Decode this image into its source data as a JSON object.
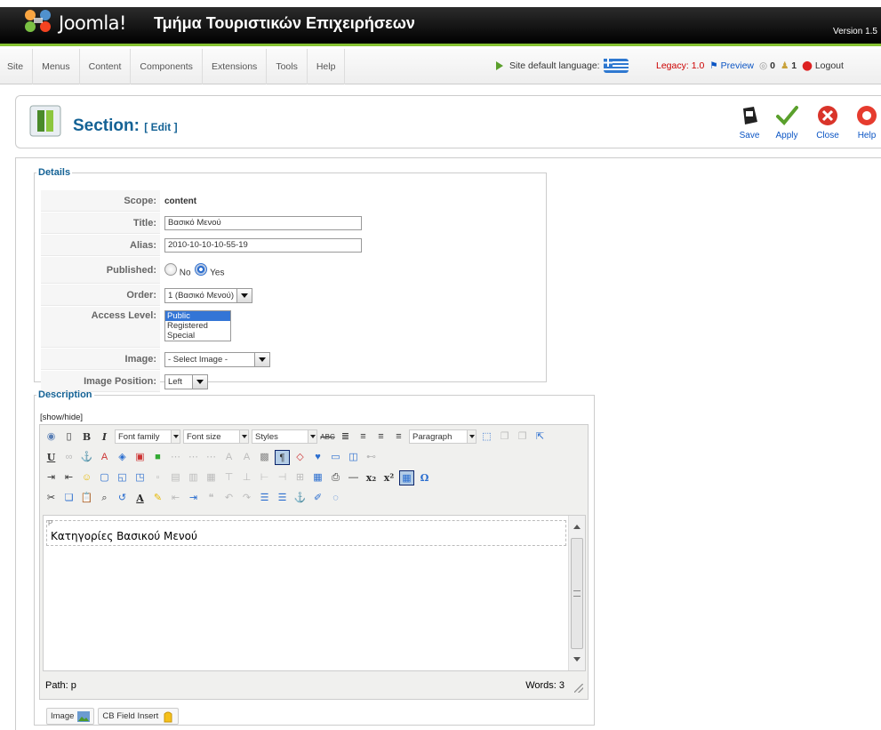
{
  "header": {
    "brand": "Joomla!",
    "site_title": "Τμήμα Τουριστικών Επιχειρήσεων",
    "version": "Version 1.5"
  },
  "menubar": {
    "items": [
      "Site",
      "Menus",
      "Content",
      "Components",
      "Extensions",
      "Tools",
      "Help"
    ],
    "site_language_label": "Site default language:",
    "legacy": "Legacy: 1.0",
    "preview": "Preview",
    "messages_count": "0",
    "users_count": "1",
    "logout": "Logout"
  },
  "toolbar": {
    "title": "Section:",
    "subtitle": "[ Edit ]",
    "save": "Save",
    "apply": "Apply",
    "close": "Close",
    "help": "Help"
  },
  "details": {
    "legend": "Details",
    "scope_label": "Scope:",
    "scope_value": "content",
    "title_label": "Title:",
    "title_value": "Βασικό Μενού",
    "alias_label": "Alias:",
    "alias_value": "2010-10-10-10-55-19",
    "published_label": "Published:",
    "published_no": "No",
    "published_yes": "Yes",
    "published_selected": "Yes",
    "order_label": "Order:",
    "order_value": "1 (Βασικό Μενού)",
    "access_label": "Access Level:",
    "access_options": [
      "Public",
      "Registered",
      "Special"
    ],
    "access_selected": "Public",
    "image_label": "Image:",
    "image_value": "- Select Image -",
    "image_position_label": "Image Position:",
    "image_position_value": "Left"
  },
  "description": {
    "legend": "Description",
    "show_hide": "[show/hide]",
    "font_family": "Font family",
    "font_size": "Font size",
    "styles": "Styles",
    "paragraph": "Paragraph",
    "content_tag": "P",
    "content": "Κατηγορίες Βασικού Μενού",
    "path": "Path: p",
    "words": "Words: 3"
  },
  "editor_buttons": {
    "image": "Image",
    "cb_field_insert": "CB Field Insert"
  },
  "colors": {
    "accent_blue": "#146295",
    "link_blue": "#0b55c4",
    "header_green": "#86c232",
    "legacy_red": "#cc0000"
  }
}
